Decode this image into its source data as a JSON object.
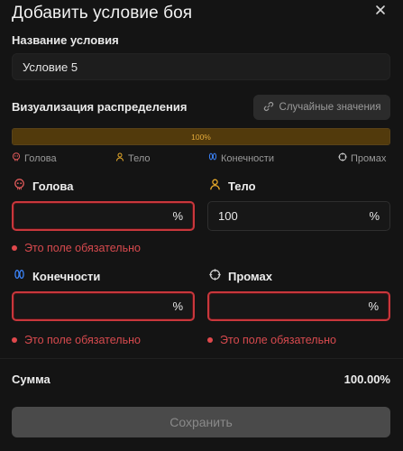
{
  "dialog": {
    "title": "Добавить условие боя",
    "close_icon": "close-icon"
  },
  "name": {
    "label": "Название условия",
    "value": "Условие 5"
  },
  "distribution": {
    "label": "Визуализация распределения",
    "random_button_label": "Случайные значения",
    "bar_label": "100%",
    "bar_fill_percent": 100,
    "colors": {
      "fill": "#523a0c",
      "text": "#e2a93a"
    },
    "legend": [
      {
        "icon": "skull-icon",
        "label": "Голова",
        "color": "#e05a5a"
      },
      {
        "icon": "person-icon",
        "label": "Тело",
        "color": "#e6a92a"
      },
      {
        "icon": "footprints-icon",
        "label": "Конечности",
        "color": "#3b82f6"
      },
      {
        "icon": "crosshair-icon",
        "label": "Промах",
        "color": "#cfcfcf"
      }
    ]
  },
  "fields": {
    "head": {
      "label": "Голова",
      "value": "",
      "unit": "%",
      "error": "Это поле обязательно"
    },
    "body": {
      "label": "Тело",
      "value": "100",
      "unit": "%"
    },
    "limbs": {
      "label": "Конечности",
      "value": "",
      "unit": "%",
      "error": "Это поле обязательно"
    },
    "miss": {
      "label": "Промах",
      "value": "",
      "unit": "%",
      "error": "Это поле обязательно"
    }
  },
  "summary": {
    "label": "Сумма",
    "value": "100.00%"
  },
  "save_button_label": "Сохранить",
  "colors": {
    "background": "#141414",
    "error": "#d84a4e",
    "accent": "#e2a93a"
  }
}
